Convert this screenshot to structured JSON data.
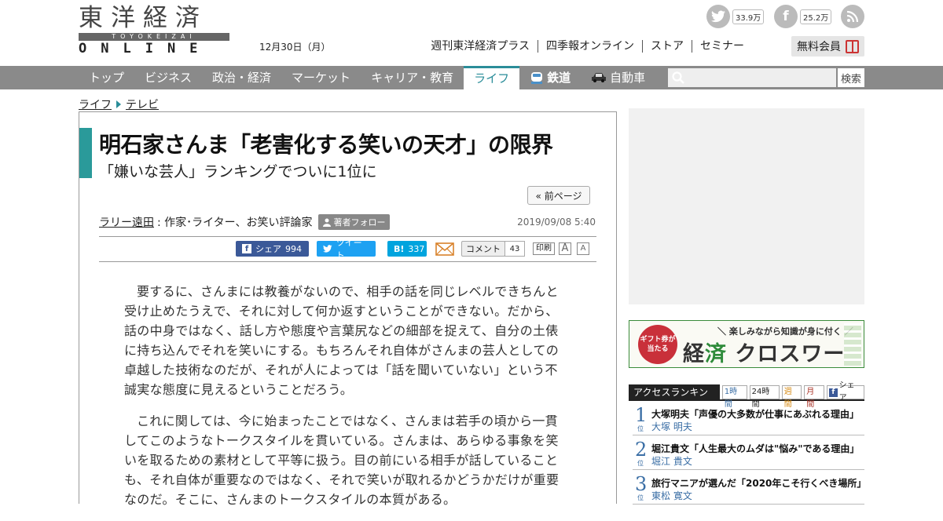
{
  "header": {
    "logo_kanji": "東洋経済",
    "logo_sub": "TOYOKEIZAI",
    "logo_online": "ONLINE",
    "date": "12月30日（月）",
    "twitter_count": "33.9万",
    "facebook_count": "25.2万",
    "links": [
      "週刊東洋経済プラス",
      "四季報オンライン",
      "ストア",
      "セミナー"
    ],
    "member_label": "無料会員"
  },
  "nav": {
    "items": [
      "トップ",
      "ビジネス",
      "政治・経済",
      "マーケット",
      "キャリア・教育",
      "ライフ"
    ],
    "special": [
      "鉄道",
      "自動車"
    ],
    "active": "ライフ",
    "search_placeholder": "",
    "search_button": "検索"
  },
  "breadcrumb": [
    "ライフ",
    "テレビ"
  ],
  "article": {
    "title": "明石家さんま「老害化する笑いの天才」の限界",
    "subtitle": "「嫌いな芸人」ランキングでついに1位に",
    "prev_page": "« 前ページ",
    "author": "ラリー遠田",
    "author_role": ": 作家･ライター、お笑い評論家",
    "follow_label": "著者フォロー",
    "date": "2019/09/08 5:40",
    "share": {
      "facebook_label": "シェア",
      "facebook_count": "994",
      "twitter_label": "ツイート",
      "hatena_label": "B!",
      "hatena_count": "337",
      "comment_label": "コメント",
      "comment_count": "43",
      "print_label": "印刷",
      "font_a": "A"
    },
    "paragraphs": [
      "要するに、さんまには教養がないので、相手の話を同じレベルできちんと受け止めたうえで、それに対して何か返すということができない。だから、話の中身ではなく、話し方や態度や言葉尻などの細部を捉えて、自分の土俵に持ち込んでそれを笑いにする。もちろんそれ自体がさんまの芸人としての卓越した技術なのだが、それが人によっては「話を聞いていない」という不誠実な態度に見えるということだろう。",
      "これに関しては、今に始まったことではなく、さんまは若手の頃から一貫してこのようなトークスタイルを貫いている。さんまは、あらゆる事象を笑いを取るための素材として平等に扱う。目の前にいる相手が話していることも、それ自体が重要なのではなく、それで笑いが取れるかどうかだけが重要なのだ。そこに、さんまのトークスタイルの本質がある。"
    ]
  },
  "sidebar": {
    "crossword": {
      "badge": "ギフト券が当たる",
      "tagline": "＼ 楽しみながら知識が身に付く ／",
      "title_a": "経",
      "title_b": "済",
      "title_c": " クロスワード"
    },
    "ranking": {
      "title": "アクセスランキング",
      "tabs": [
        "1時間",
        "24時間",
        "週間",
        "月間",
        "シェア"
      ],
      "rank_suffix": "位",
      "items": [
        {
          "rank": "1",
          "headline": "大塚明夫「声優の大多数が仕事にあぶれる理由」",
          "author": "大塚 明夫"
        },
        {
          "rank": "2",
          "headline": "堀江貴文「人生最大のムダは\"悩み\"である理由」",
          "author": "堀江 貴文"
        },
        {
          "rank": "3",
          "headline": "旅行マニアが選んだ「2020年こそ行くべき場所」",
          "author": "東松 寛文"
        }
      ]
    }
  },
  "colors": {
    "accent": "#2a9a9a",
    "nav_bg": "#8a8a8a",
    "facebook": "#3b5998",
    "twitter": "#1da1f2",
    "hatena": "#00a4de",
    "ranking_blue": "#3a6ea5"
  }
}
